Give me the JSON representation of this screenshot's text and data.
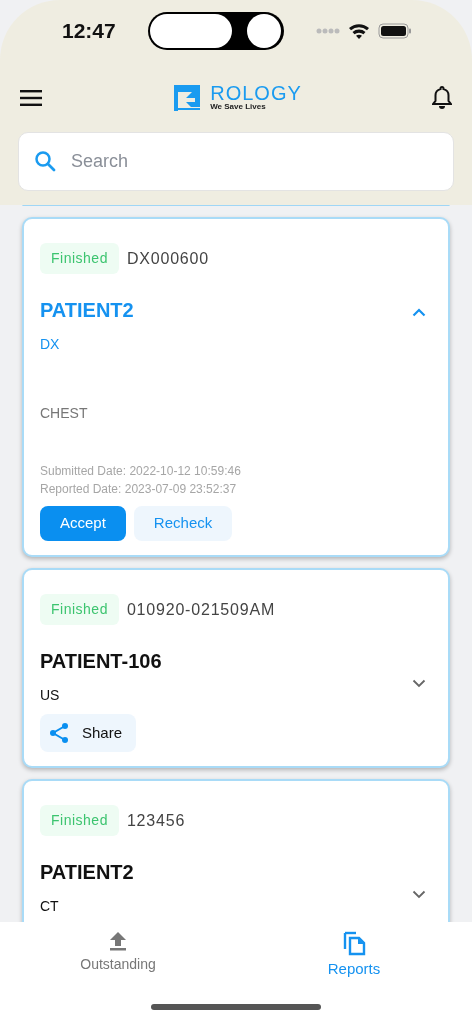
{
  "status_bar": {
    "time": "12:47"
  },
  "header": {
    "brand": "ROLOGY",
    "tagline": "We Save Lives"
  },
  "search": {
    "placeholder": "Search"
  },
  "cards": [
    {
      "status": "Finished",
      "accession": "DX000600",
      "patient": "PATIENT2",
      "expanded": true,
      "modality": "DX",
      "body_part": "CHEST",
      "submitted": "Submitted Date: 2022-10-12 10:59:46",
      "reported": "Reported Date: 2023-07-09 23:52:37",
      "actions": [
        {
          "label": "Accept",
          "kind": "primary"
        },
        {
          "label": "Recheck",
          "kind": "secondary"
        }
      ]
    },
    {
      "status": "Finished",
      "accession": "010920-021509AM",
      "patient": "PATIENT-106",
      "expanded": false,
      "modality": "US",
      "actions": [
        {
          "label": "Share",
          "kind": "share"
        }
      ]
    },
    {
      "status": "Finished",
      "accession": "123456",
      "patient": "PATIENT2",
      "expanded": false,
      "modality": "CT"
    }
  ],
  "tabs": [
    {
      "label": "Outstanding",
      "selected": false
    },
    {
      "label": "Reports",
      "selected": true
    }
  ]
}
